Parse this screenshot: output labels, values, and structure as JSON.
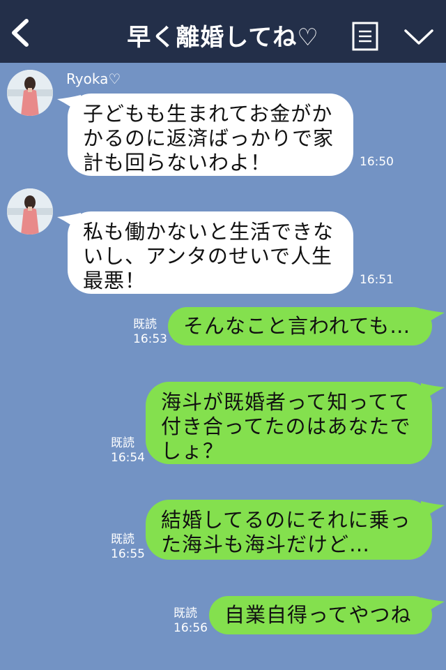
{
  "header": {
    "title": "早く離婚してね♡"
  },
  "contact": {
    "name": "Ryoka♡"
  },
  "messages": [
    {
      "text": "子どもも生まれてお金がかかるのに返済ばっかりで家計も回らないわよ！",
      "time": "16:50"
    },
    {
      "text": "私も働かないと生活できないし、アンタのせいで人生最悪！",
      "time": "16:51"
    },
    {
      "text": "そんなこと言われても…",
      "time": "16:53",
      "read": "既読"
    },
    {
      "text": "海斗が既婚者って知ってて付き合ってたのはあなたでしょ？",
      "time": "16:54",
      "read": "既読"
    },
    {
      "text": "結婚してるのにそれに乗った海斗も海斗だけど…",
      "time": "16:55",
      "read": "既読"
    },
    {
      "text": "自業自得ってやつね",
      "time": "16:56",
      "read": "既読"
    }
  ],
  "colors": {
    "header_bg": "#232f49",
    "chat_bg": "#7393c4",
    "incoming_bubble": "#ffffff",
    "outgoing_bubble": "#84e04e"
  },
  "icons": [
    "back-arrow-icon",
    "menu-list-icon",
    "chevron-down-icon"
  ]
}
